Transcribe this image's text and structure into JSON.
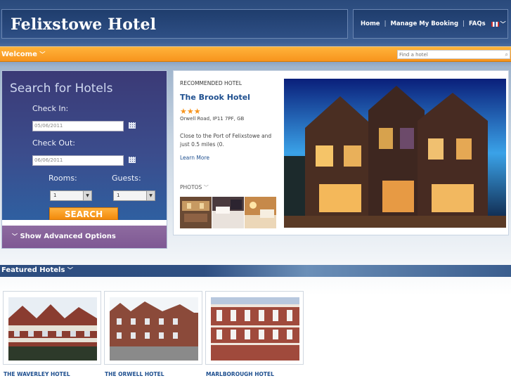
{
  "header": {
    "site_title": "Felixstowe Hotel",
    "nav": [
      "Home",
      "Manage My Booking",
      "FAQs"
    ],
    "separator": "|"
  },
  "welcome": {
    "label": "Welcome",
    "search_placeholder": "Find a hotel"
  },
  "search_panel": {
    "title": "Search for Hotels",
    "check_in_label": "Check In:",
    "check_in_value": "05/06/2011",
    "check_out_label": "Check Out:",
    "check_out_value": "06/06/2011",
    "rooms_label": "Rooms:",
    "rooms_value": "1",
    "guests_label": "Guests:",
    "guests_value": "1",
    "search_button": "SEARCH",
    "advanced_options": "Show Advanced Options"
  },
  "recommended": {
    "kicker": "RECOMMENDED HOTEL",
    "name": "The Brook Hotel",
    "stars": "★★★",
    "rating": 3,
    "address": "Orwell Road, IP11 7PF, GB",
    "description": "Close to the Port of Felixstowe and just 0.5 miles (0.",
    "learn_more": "Learn More",
    "photos_label": "PHOTOS"
  },
  "featured": {
    "label": "Featured Hotels",
    "hotels": [
      {
        "name": "THE WAVERLEY HOTEL"
      },
      {
        "name": "THE ORWELL HOTEL"
      },
      {
        "name": "MARLBOROUGH HOTEL"
      }
    ]
  },
  "colors": {
    "brand_navy": "#2a4a7c",
    "accent_orange": "#f7941d",
    "link_blue": "#1e4f8f",
    "advanced_purple": "#8e6ba0"
  },
  "icons": {
    "dropdown": "chevron-down-icon",
    "language": "flag-icon",
    "search": "magnifier-icon",
    "calendar": "calendar-icon"
  }
}
